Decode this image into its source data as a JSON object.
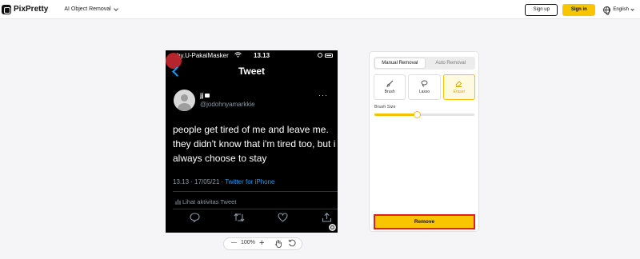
{
  "header": {
    "logo_text": "PixPretty",
    "tool_select": "AI Object Removal",
    "signup_label": "Sign up",
    "signin_label": "Sign in",
    "language": "English"
  },
  "tweet": {
    "carrier": "by.U-PakaiMasker",
    "time": "13.13",
    "title": "Tweet",
    "username": "jj",
    "handle": "@jodohnyamarkkie",
    "more": "···",
    "text": "people get tired of me and leave me. they didn't know that i'm tired too, but i always choose to stay",
    "timestamp": "13.13 · 17/05/21 · ",
    "source": "Twitter for iPhone",
    "activity": "Lihat aktivitas Tweet"
  },
  "zoom": {
    "minus": "—",
    "level": "100%",
    "plus": "+"
  },
  "panel": {
    "tabs": [
      {
        "label": "Manual Removal",
        "active": true
      },
      {
        "label": "Auto Removal",
        "active": false
      }
    ],
    "tools": [
      {
        "label": "Brush",
        "icon": "brush-icon"
      },
      {
        "label": "Lasso",
        "icon": "lasso-icon"
      },
      {
        "label": "Eraser",
        "icon": "eraser-icon",
        "active": true
      }
    ],
    "brush_size_label": "Brush Size",
    "brush_size_value": 0.43,
    "remove_label": "Remove"
  },
  "colors": {
    "accent": "#f9c500",
    "remove_border": "#e02020",
    "link": "#1d9bf0"
  }
}
